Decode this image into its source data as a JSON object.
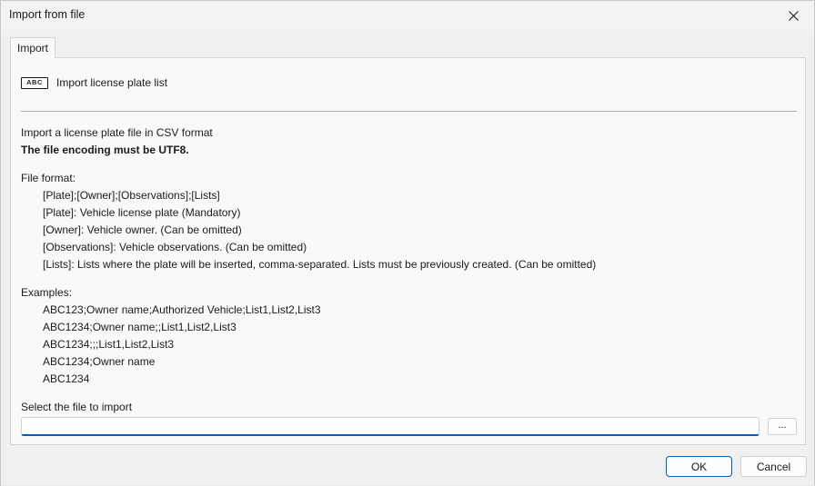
{
  "window": {
    "title": "Import from file"
  },
  "tabs": [
    {
      "label": "Import",
      "selected": true
    }
  ],
  "header": {
    "icon_text": "ABC",
    "label": "Import license plate list"
  },
  "intro": {
    "line1": "Import a license plate file in CSV format",
    "line2": "The file encoding must be UTF8."
  },
  "file_format": {
    "heading": "File format:",
    "lines": [
      "[Plate];[Owner];[Observations];[Lists]",
      "[Plate]: Vehicle license plate (Mandatory)",
      "[Owner]: Vehicle owner. (Can be omitted)",
      "[Observations]: Vehicle observations. (Can be omitted)",
      "[Lists]: Lists where the plate will be inserted, comma-separated. Lists must be previously created. (Can be omitted)"
    ]
  },
  "examples": {
    "heading": "Examples:",
    "lines": [
      "ABC123;Owner name;Authorized Vehicle;List1,List2,List3",
      "ABC1234;Owner name;;List1,List2,List3",
      "ABC1234;;;List1,List2,List3",
      "ABC1234;Owner name",
      "ABC1234"
    ]
  },
  "file_select": {
    "label": "Select the file to import",
    "value": "",
    "browse_label": "..."
  },
  "buttons": {
    "ok": "OK",
    "cancel": "Cancel"
  },
  "colors": {
    "accent": "#005fb8"
  }
}
